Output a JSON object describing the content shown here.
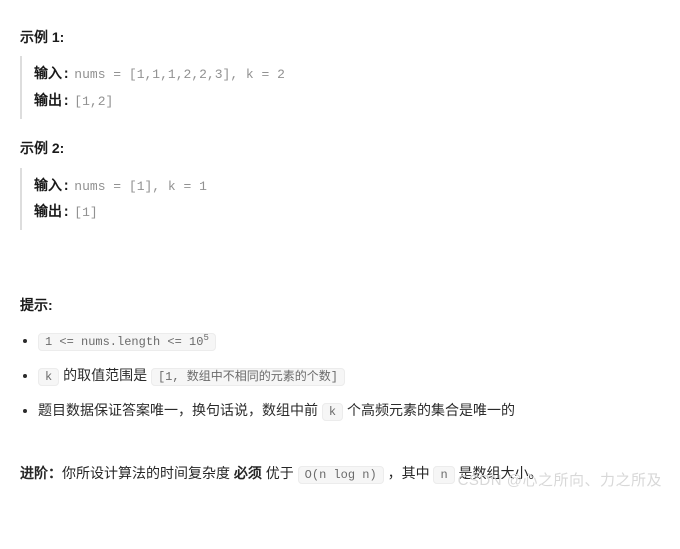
{
  "example1": {
    "title": "示例 1:",
    "inputLabel": "输入:",
    "inputValue": "nums = [1,1,1,2,2,3], k = 2",
    "outputLabel": "输出:",
    "outputValue": "[1,2]"
  },
  "example2": {
    "title": "示例 2:",
    "inputLabel": "输入:",
    "inputValue": "nums = [1], k = 1",
    "outputLabel": "输出:",
    "outputValue": "[1]"
  },
  "hints": {
    "title": "提示:",
    "item1_code": "1 <= nums.length <= 10",
    "item1_sup": "5",
    "item2_prefix_code": "k",
    "item2_text": " 的取值范围是 ",
    "item2_code": "[1, 数组中不相同的元素的个数]",
    "item3_text1": "题目数据保证答案唯一，换句话说，数组中前 ",
    "item3_code": "k",
    "item3_text2": " 个高频元素的集合是唯一的"
  },
  "advanced": {
    "label": "进阶：",
    "text1": "你所设计算法的时间复杂度 ",
    "must": "必须",
    "text2": " 优于 ",
    "code1": "O(n log n)",
    "text3": " ，其中 ",
    "code2": "n",
    "text4": " 是数组大小。"
  },
  "watermark": "CSDN @心之所向、力之所及"
}
